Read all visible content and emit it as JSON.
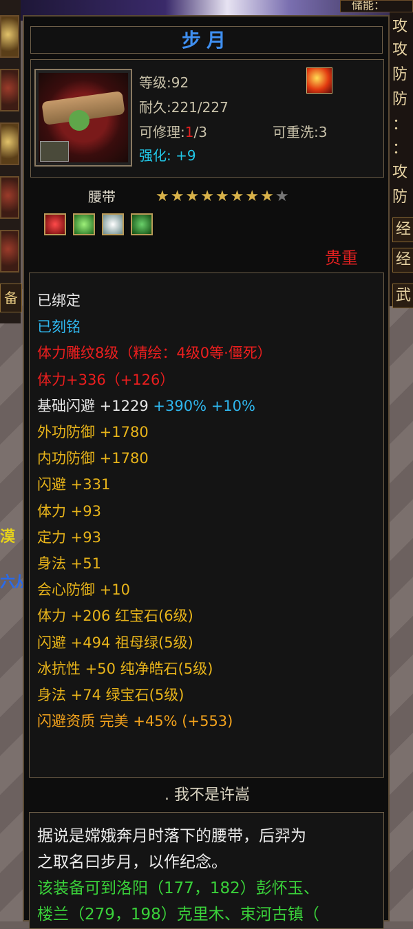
{
  "window": {
    "right_top_label": "储能："
  },
  "item": {
    "name": "步月",
    "level": "等级:92",
    "durability": "耐久:221/227",
    "repair_label": "可修理:",
    "repair_used": "1",
    "repair_total": "/3",
    "rewash": "可重洗:3",
    "enhance_label": "强化:",
    "enhance_value": "+9",
    "type": "腰带",
    "stars_filled": 8,
    "stars_total": 9,
    "rarity": "贵重",
    "owner": ". 我不是许嵩"
  },
  "attributes": [
    {
      "text": "已绑定",
      "class": "white"
    },
    {
      "text": "已刻铭",
      "class": "blue"
    },
    {
      "text": "体力雕纹8级（精绘：4级0等·僵死）",
      "class": "redtxt"
    },
    {
      "text": "体力+336（+126）",
      "class": "redtxt"
    },
    {
      "text": "基础闪避 +1229",
      "class": "white",
      "extra": " +390% +10%"
    },
    {
      "text": "外功防御 +1780",
      "class": ""
    },
    {
      "text": "内功防御 +1780",
      "class": ""
    },
    {
      "text": "闪避 +331",
      "class": ""
    },
    {
      "text": "体力 +93",
      "class": ""
    },
    {
      "text": "定力 +93",
      "class": ""
    },
    {
      "text": "身法 +51",
      "class": ""
    },
    {
      "text": "会心防御 +10",
      "class": ""
    },
    {
      "text": "体力 +206 红宝石(6级)",
      "class": ""
    },
    {
      "text": "闪避 +494 祖母绿(5级)",
      "class": ""
    },
    {
      "text": "冰抗性 +50 纯净皓石(5级)",
      "class": ""
    },
    {
      "text": "身法 +74 绿宝石(5级)",
      "class": ""
    },
    {
      "text": "闪避资质   完美 +45% (+553)",
      "class": "orange"
    }
  ],
  "description": {
    "line1": "据说是嫦娥奔月时落下的腰带，后羿为",
    "line2": "之取名曰步月，以作纪念。",
    "line3": "该装备可到洛阳（177，182）彭怀玉、",
    "line4": "楼兰（279，198）克里木、束河古镇（"
  },
  "right_column": [
    "攻",
    "攻",
    "防",
    "防",
    "：",
    "：",
    "攻",
    "防",
    "经",
    "经",
    "武"
  ],
  "left_strip": {
    "tab": "备",
    "text1": "漠",
    "text2": "六从"
  },
  "icons": {
    "enhance_badge": "fire-bird-icon",
    "gems": [
      "red-gem-icon",
      "green-gem-icon",
      "white-gem-icon",
      "emerald-gem-icon"
    ]
  },
  "colors": {
    "title": "#3f8ff0",
    "rarity": "#e02020",
    "attr": "#e8b41a",
    "blue": "#2fb7ee",
    "green": "#3ad23a"
  }
}
